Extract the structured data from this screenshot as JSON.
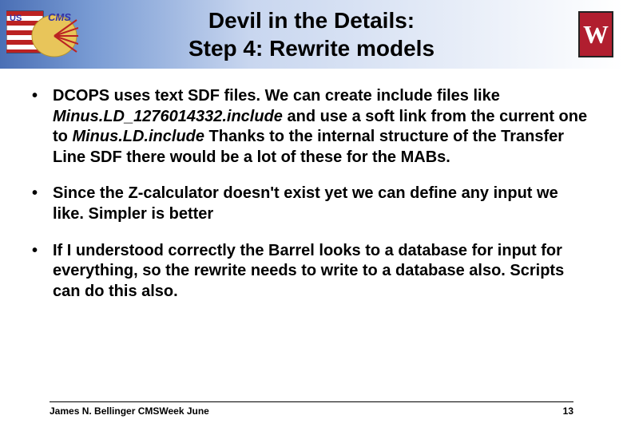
{
  "title_line1": "Devil in the Details:",
  "title_line2": "Step 4: Rewrite models",
  "logo_left_text_us": "US",
  "logo_left_text_cms": "CMS",
  "logo_right_letter": "W",
  "bullets": {
    "b1_a": "DCOPS uses text SDF files.  We can create include files like ",
    "b1_italic1": "Minus.LD_1276014332.include",
    "b1_b": "  and use a soft link from the current one to ",
    "b1_italic2": "Minus.LD.include",
    "b1_c": "  Thanks to the internal structure of the Transfer Line SDF there would be a lot of these for the MABs.",
    "b2": "Since the Z-calculator doesn't exist yet we can define any input we like.  Simpler is better",
    "b3": "If I understood correctly the Barrel looks to a database for input for everything, so the rewrite needs to write to a database also.  Scripts can do this also."
  },
  "footer_author": "James N. Bellinger CMSWeek June",
  "footer_page": "13"
}
